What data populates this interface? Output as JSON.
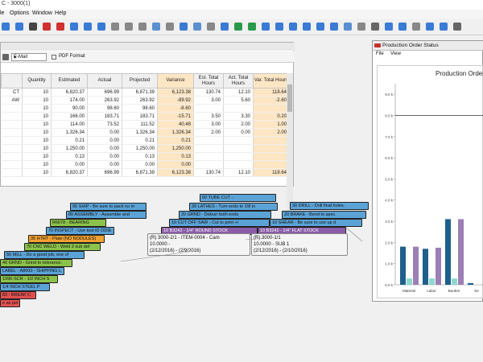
{
  "app": {
    "title": "C - 3000(1)"
  },
  "menu": [
    "le",
    "Options",
    "Window",
    "Help"
  ],
  "toolbar": {
    "icons": [
      "back-icon",
      "forward-icon",
      "print-icon",
      "delete-icon",
      "close-icon",
      "save-icon",
      "copy-icon",
      "mail-icon",
      "page-icon",
      "page-icon",
      "page-icon",
      "edit-icon",
      "page-icon",
      "grid-icon",
      "edit-icon",
      "page-icon",
      "grid-icon",
      "refresh-icon",
      "money-icon",
      "tag-icon",
      "chart-icon",
      "filter-icon",
      "calendar-icon",
      "filter-icon",
      "grid-icon",
      "edit-icon",
      "page-icon",
      "tools-icon",
      "filter-icon",
      "grid-icon",
      "paste-icon",
      "list-icon",
      "chart-icon",
      "tools-icon"
    ]
  },
  "report": {
    "delivery": "E-Mail",
    "pdf_label": "PDF Format",
    "columns": [
      "",
      "Quantity",
      "Estimated",
      "Actual",
      "Projected",
      "Variance",
      "Est. Total Hours",
      "Act. Total Hours",
      "Var. Total Hours"
    ],
    "rows": [
      [
        "CT",
        "10",
        "6,820.37",
        "696.99",
        "6,871.39",
        "6,123.38",
        "130.74",
        "12.10",
        "118.64"
      ],
      [
        "AW",
        "10",
        "174.00",
        "263.92",
        "263.92",
        "-89.92",
        "3.00",
        "5.60",
        "-2.60"
      ],
      [
        "",
        "10",
        "90.00",
        "98.60",
        "98.60",
        "-8.60",
        "",
        "",
        ""
      ],
      [
        "",
        "10",
        "166.00",
        "183.71",
        "183.71",
        "-15.71",
        "3.50",
        "3.30",
        "0.20"
      ],
      [
        "",
        "10",
        "114.00",
        "73.52",
        "111.52",
        "40.48",
        "3.00",
        "2.00",
        "1.00"
      ],
      [
        "",
        "10",
        "1,326.34",
        "0.00",
        "1,326.34",
        "1,326.34",
        "2.00",
        "0.00",
        "2.00"
      ],
      [
        "",
        "10",
        "0.21",
        "0.00",
        "0.21",
        "0.21",
        "",
        "",
        ""
      ],
      [
        "",
        "10",
        "1,250.00",
        "0.00",
        "1,250.00",
        "1,250.00",
        "",
        "",
        ""
      ],
      [
        "",
        "10",
        "0.13",
        "0.00",
        "0.13",
        "0.13",
        "",
        "",
        ""
      ],
      [
        "",
        "10",
        "0.00",
        "0.00",
        "0.00",
        "0.00",
        "",
        "",
        ""
      ],
      [
        "",
        "10",
        "6,820.37",
        "696.99",
        "6,871.39",
        "6,123.38",
        "130.74",
        "12.10",
        "118.64"
      ]
    ]
  },
  "schedule": {
    "bars": [
      {
        "text": "90 SHIP - Be sure to pack no m",
        "color": "blue"
      },
      {
        "text": "80 ASSEMBLY - Assemble and",
        "color": "blue"
      },
      {
        "text": "R6678 - BEARING",
        "color": "green"
      },
      {
        "text": "70 INSPECT - Use test ID ODIE",
        "color": "blue"
      },
      {
        "text": "35 HTRT - Plate (NO NODULES)",
        "color": "orange"
      },
      {
        "text": "70 CNC WELD - Weld 2 sub def",
        "color": "green"
      },
      {
        "text": "50 MILL - Do a good job, one of",
        "color": "blue"
      },
      {
        "text": "40 GRND - Grind to tolerance.",
        "color": "green"
      },
      {
        "text": "LABEL - A8000 - SHIPPING L",
        "color": "blue"
      },
      {
        "text": "1996-SCR - 1/2 INCH S",
        "color": "green"
      },
      {
        "text": "1/4 INCH STEEL P",
        "color": "blue"
      },
      {
        "text": "83 - BREAK C",
        "color": "red"
      },
      {
        "text": "e as per p",
        "color": "red"
      },
      {
        "text": "60 TUBE CUT -",
        "color": "blue"
      },
      {
        "text": "30 LATHES - Turn ends to 1/8 in",
        "color": "blue"
      },
      {
        "text": "20 GRND - Deburr both ends",
        "color": "blue"
      },
      {
        "text": "10 CUT OFF SAW - Cut to print +/",
        "color": "blue"
      },
      {
        "text": "10 B3242 - 1/4\" ROUND STOCK",
        "color": "purple"
      },
      {
        "text": "30 DRILL - Drill final holes.",
        "color": "blue"
      },
      {
        "text": "20 BRAKE - Bend to spec.",
        "color": "blue"
      },
      {
        "text": "10 SHEAR - Be sure to use up d",
        "color": "blue"
      },
      {
        "text": "10 B3242 - 1/4\" FLAT STOCK",
        "color": "purple"
      }
    ],
    "tips": [
      {
        "l1": "(R) 3000-2/1 - ITEM-0004 - Cam",
        "l2": "10.0000 -",
        "l3": "(2/12/2016) - (2/9/2016)"
      },
      {
        "l1": "(R) 3000-1/1",
        "l2": "10.0000 - SUB 1",
        "l3": "(2/12/2016) - (2/10/2016)"
      }
    ]
  },
  "pos": {
    "title": "Production Order Status",
    "menu": [
      "File",
      "View"
    ],
    "chart_title": "Production Order"
  },
  "chart_data": {
    "type": "bar",
    "title": "Production Order",
    "categories": [
      "Material",
      "Labor",
      "Burden",
      "Se"
    ],
    "yticks": [
      "9.0 k",
      "8.0 k",
      "7.0 k",
      "6.0 k",
      "5.0 k",
      "4.0 k",
      "3.0 k",
      "2.0 k",
      "1.0 k",
      "0.0 k"
    ],
    "ylim": [
      0,
      9500
    ],
    "reference_line": 8000,
    "series": [
      {
        "color": "#1f5f8b",
        "values": [
          1800,
          1700,
          3100,
          80
        ]
      },
      {
        "color": "#8fd8d0",
        "values": [
          300,
          300,
          300,
          0
        ]
      },
      {
        "color": "#9b7fb5",
        "values": [
          1800,
          1750,
          3100,
          0
        ]
      }
    ]
  }
}
